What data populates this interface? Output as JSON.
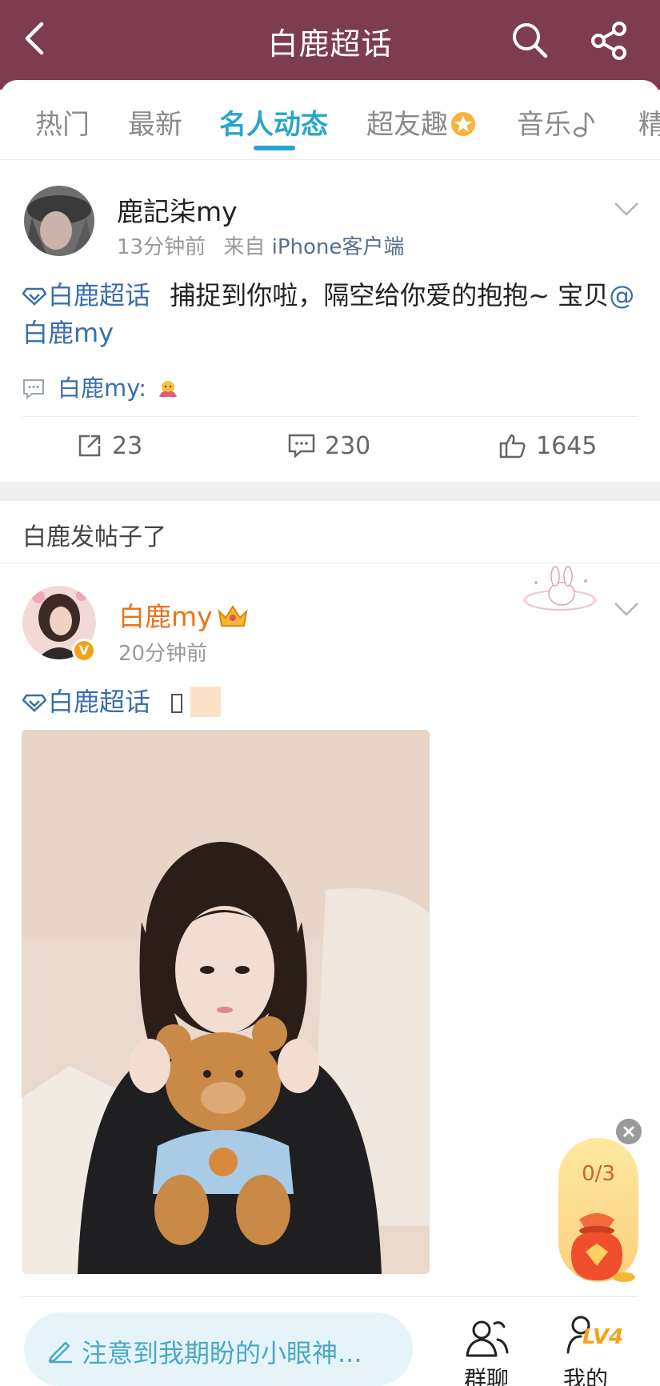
{
  "header": {
    "title": "白鹿超话",
    "back_icon": "chevron-left-icon",
    "search_icon": "search-icon",
    "share_icon": "share-icon",
    "background": "#7e3c50"
  },
  "tabs": [
    {
      "label": "热门",
      "active": false
    },
    {
      "label": "最新",
      "active": false
    },
    {
      "label": "名人动态",
      "active": true
    },
    {
      "label": "超友趣",
      "active": false,
      "icon": "star-badge-icon"
    },
    {
      "label": "音乐",
      "active": false,
      "icon": "music-note-icon"
    },
    {
      "label": "精",
      "active": false
    }
  ],
  "accent_color": "#2aa6c9",
  "post1": {
    "author": "鹿記柒my",
    "time": "13分钟前",
    "source_prefix": "来自",
    "source": "iPhone客户端",
    "topic": "白鹿超话",
    "text": "捕捉到你啦，隔空给你爱的抱抱~ 宝贝",
    "mention": "@白鹿my",
    "comment_user": "白鹿my:",
    "reposts": "23",
    "comments": "230",
    "likes": "1645"
  },
  "section_label": "白鹿发帖子了",
  "post2": {
    "author": "白鹿my",
    "time": "20分钟前",
    "topic": "白鹿超话",
    "verified_badge": "V"
  },
  "floating_task": {
    "progress": "0/3"
  },
  "bottom_bar": {
    "compose_placeholder": "注意到我期盼的小眼神...",
    "group_chat_label": "群聊",
    "mine_label": "我的",
    "level": "LV4"
  }
}
